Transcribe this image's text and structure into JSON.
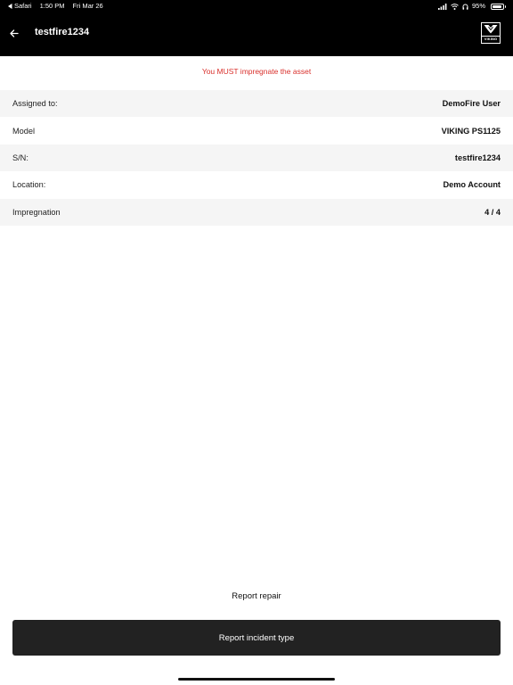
{
  "status_bar": {
    "back_app": "Safari",
    "time": "1:50 PM",
    "date": "Fri Mar 26",
    "battery_text": "95%",
    "battery_level": 0.95,
    "icons": [
      "signal-icon",
      "wifi-icon",
      "headphones-icon",
      "battery-icon"
    ]
  },
  "header": {
    "title": "testfire1234",
    "back_icon": "arrow-left-icon",
    "logo_text": "VIKING",
    "background_color": "#000000"
  },
  "warning": {
    "text": "You MUST impregnate the asset",
    "color": "#d9302c"
  },
  "details": [
    {
      "label": "Assigned to:",
      "value": "DemoFire User"
    },
    {
      "label": "Model",
      "value": "VIKING PS1125"
    },
    {
      "label": "S/N:",
      "value": "testfire1234"
    },
    {
      "label": "Location:",
      "value": "Demo Account"
    },
    {
      "label": "Impregnation",
      "value": "4 / 4"
    }
  ],
  "actions": {
    "report_repair": "Report repair",
    "report_incident": "Report incident type"
  }
}
